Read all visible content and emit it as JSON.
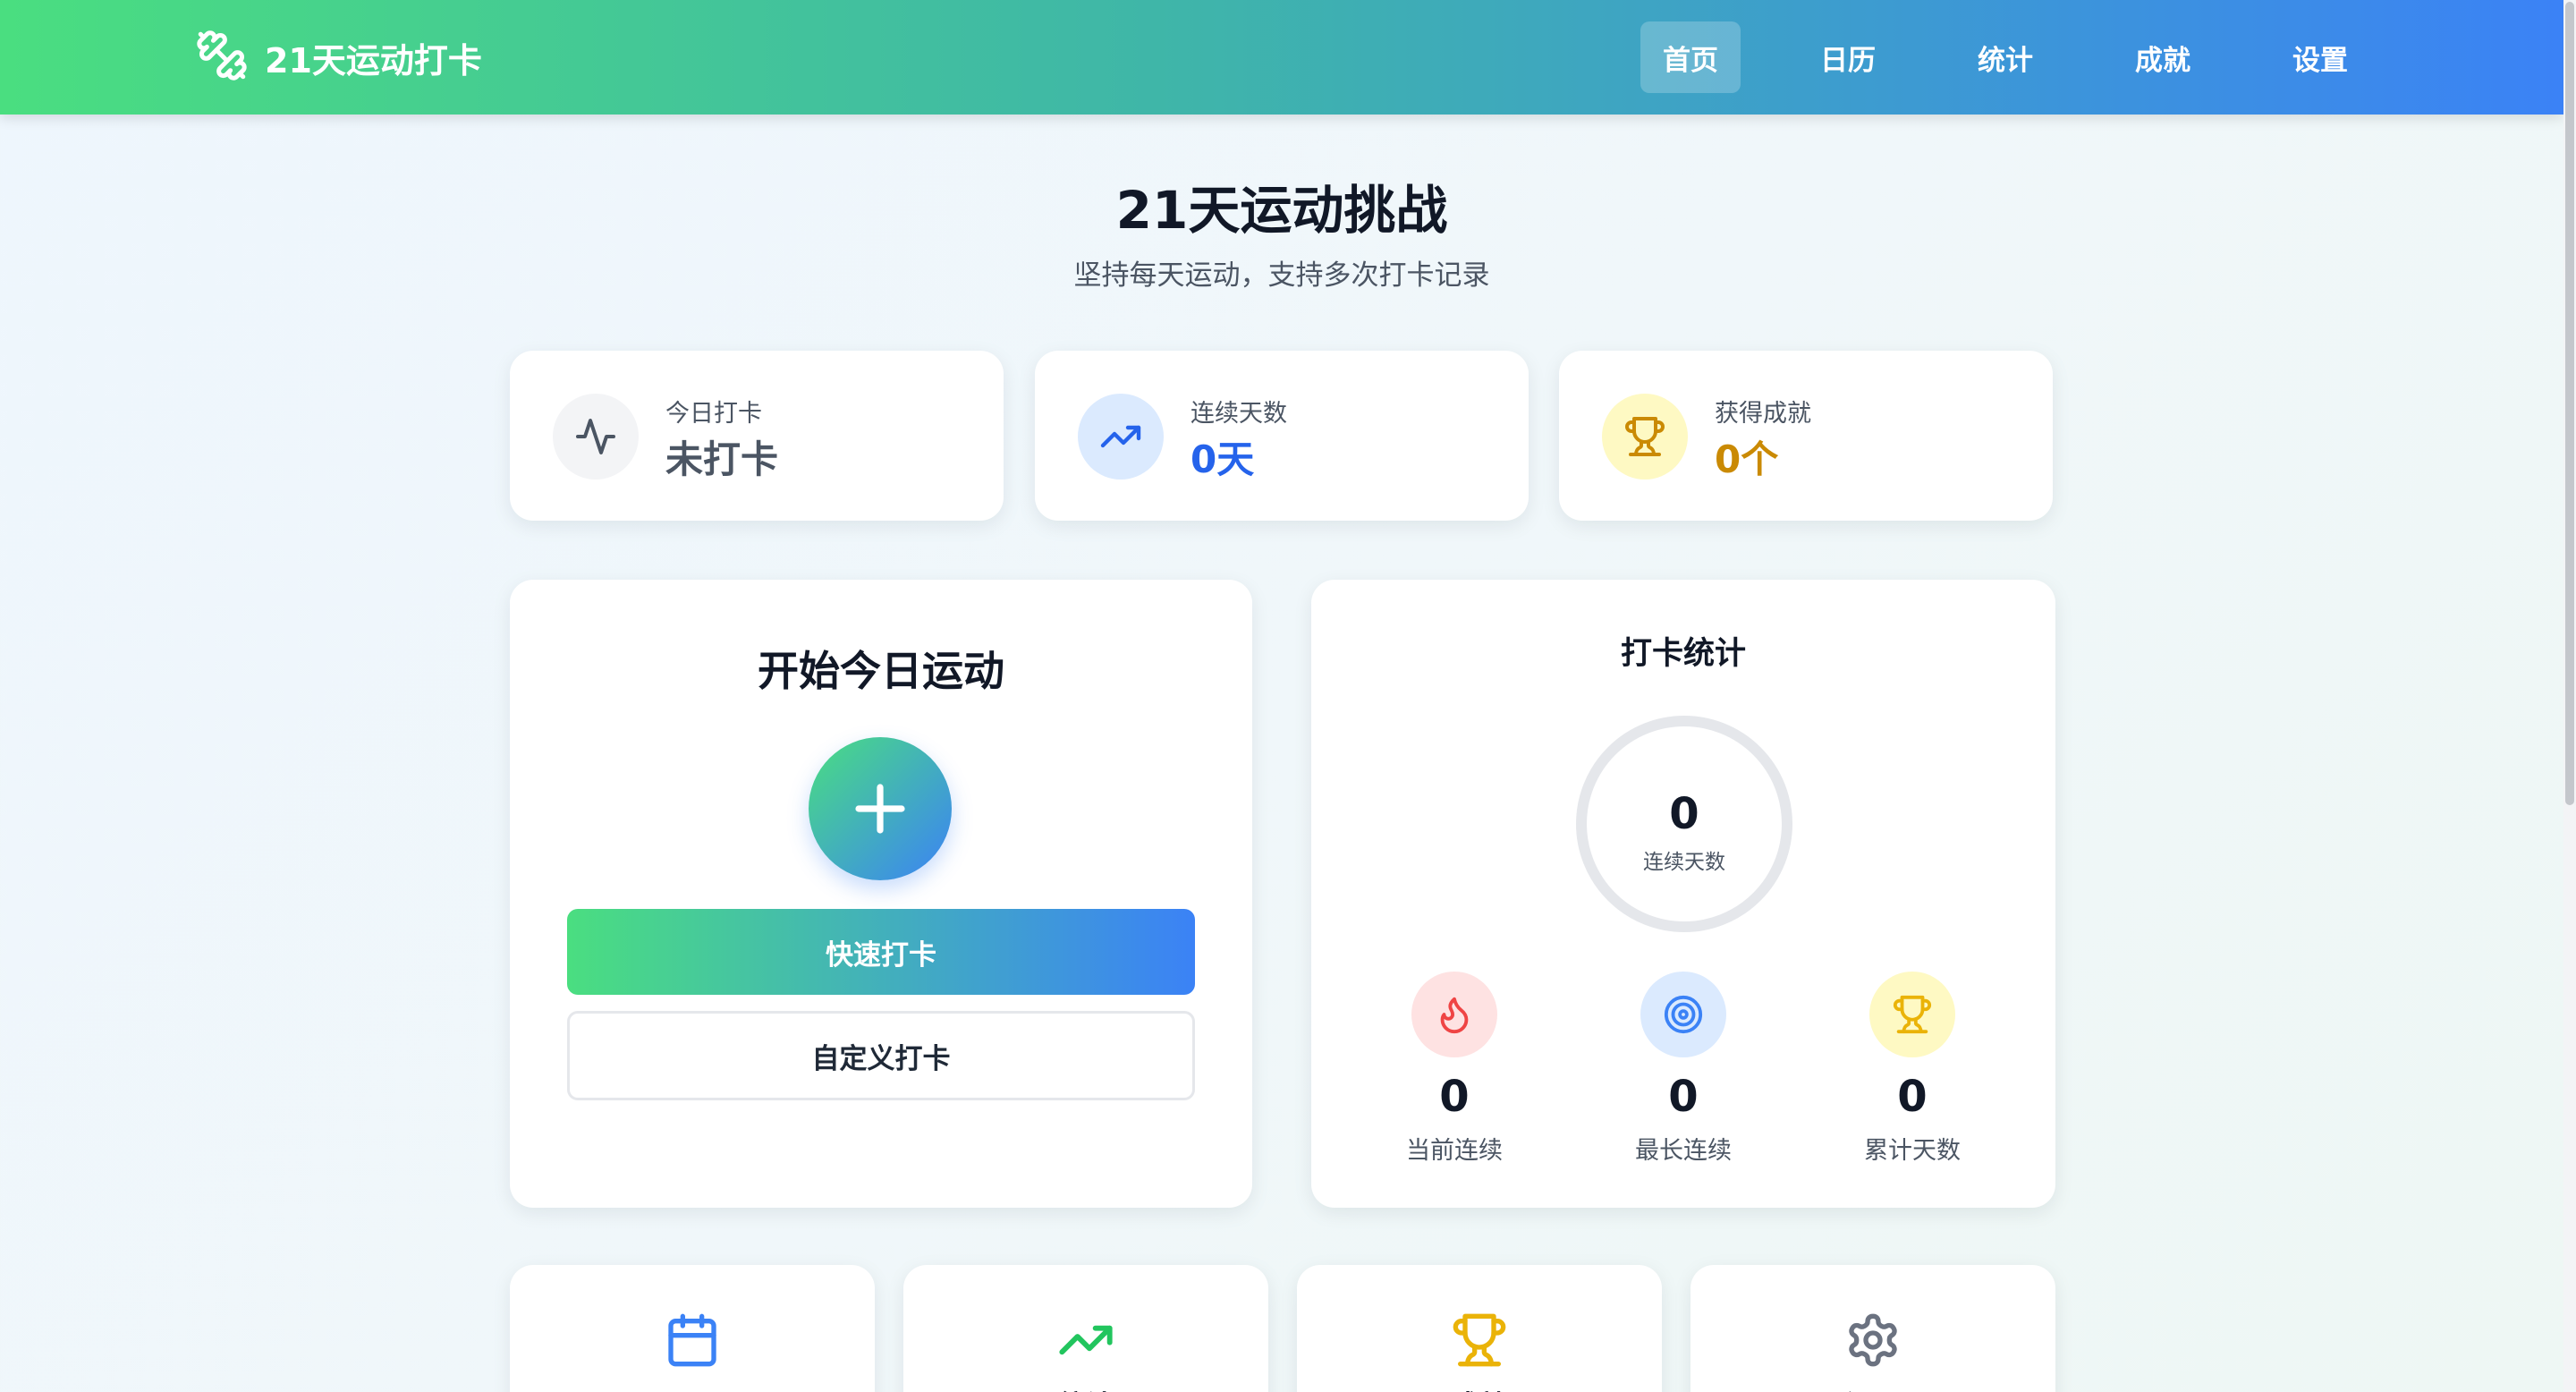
{
  "app": {
    "title": "21天运动打卡",
    "brand_icon": "dumbbell-icon"
  },
  "nav": {
    "items": [
      {
        "label": "首页",
        "active": true
      },
      {
        "label": "日历",
        "active": false
      },
      {
        "label": "统计",
        "active": false
      },
      {
        "label": "成就",
        "active": false
      },
      {
        "label": "设置",
        "active": false
      }
    ]
  },
  "hero": {
    "title": "21天运动挑战",
    "subtitle": "坚持每天运动，支持多次打卡记录"
  },
  "summary": {
    "today": {
      "label": "今日打卡",
      "value": "未打卡",
      "icon": "activity-icon",
      "color": "#4b5563"
    },
    "streak": {
      "label": "连续天数",
      "value": "0天",
      "icon": "trending-up-icon",
      "color": "#2563eb"
    },
    "achievements": {
      "label": "获得成就",
      "value": "0个",
      "icon": "trophy-icon",
      "color": "#ca8a04"
    }
  },
  "checkin": {
    "title": "开始今日运动",
    "quick_label": "快速打卡",
    "custom_label": "自定义打卡"
  },
  "stats": {
    "title": "打卡统计",
    "ring_value": "0",
    "ring_label": "连续天数",
    "current_streak": {
      "value": "0",
      "label": "当前连续",
      "icon": "flame-icon"
    },
    "longest_streak": {
      "value": "0",
      "label": "最长连续",
      "icon": "target-icon"
    },
    "total_days": {
      "value": "0",
      "label": "累计天数",
      "icon": "trophy-icon"
    }
  },
  "quick_nav": [
    {
      "label": "日历",
      "icon": "calendar-icon",
      "color": "#3b82f6"
    },
    {
      "label": "统计",
      "icon": "trending-up-icon",
      "color": "#22c55e"
    },
    {
      "label": "成就",
      "icon": "trophy-icon",
      "color": "#eab308"
    },
    {
      "label": "设置",
      "icon": "settings-icon",
      "color": "#6b7280"
    }
  ],
  "colors": {
    "gradient_start": "#4ade80",
    "gradient_end": "#3b82f6",
    "streak_blue": "#2563eb",
    "achievement_gold": "#ca8a04"
  }
}
